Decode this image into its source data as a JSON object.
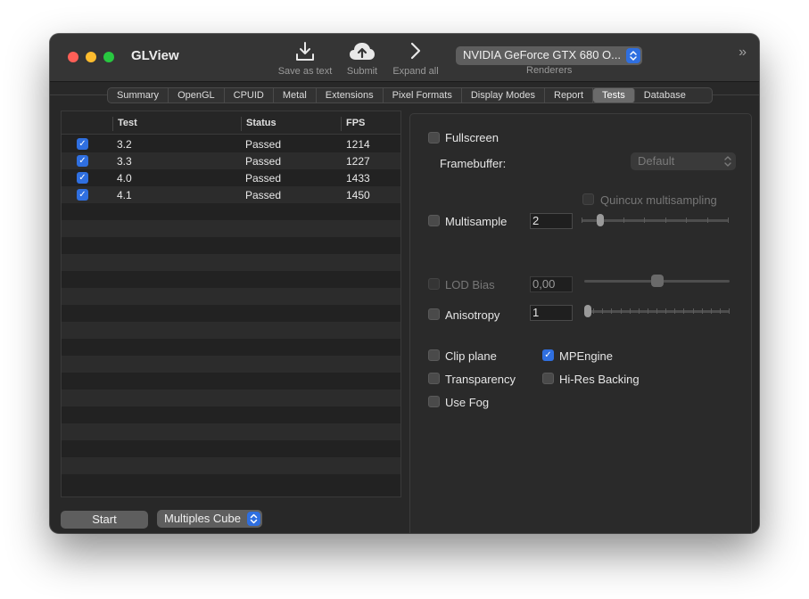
{
  "window": {
    "title": "GLView"
  },
  "toolbar": {
    "save_label": "Save as text",
    "submit_label": "Submit",
    "expand_label": "Expand all",
    "renderer_value": "NVIDIA GeForce GTX 680 O...",
    "renderers_label": "Renderers",
    "overflow_glyph": "»"
  },
  "tabs": [
    "Summary",
    "OpenGL",
    "CPUID",
    "Metal",
    "Extensions",
    "Pixel Formats",
    "Display Modes",
    "Report",
    "Tests",
    "Database"
  ],
  "active_tab": "Tests",
  "table": {
    "headers": {
      "test": "Test",
      "status": "Status",
      "fps": "FPS"
    },
    "rows": [
      {
        "checked": true,
        "test": "3.2",
        "status": "Passed",
        "fps": "1214"
      },
      {
        "checked": true,
        "test": "3.3",
        "status": "Passed",
        "fps": "1227"
      },
      {
        "checked": true,
        "test": "4.0",
        "status": "Passed",
        "fps": "1433"
      },
      {
        "checked": true,
        "test": "4.1",
        "status": "Passed",
        "fps": "1450"
      }
    ]
  },
  "bottom": {
    "start_label": "Start",
    "test_select_value": "Multiples Cube"
  },
  "settings": {
    "fullscreen_label": "Fullscreen",
    "framebuffer_label": "Framebuffer:",
    "framebuffer_value": "Default",
    "quincux_label": "Quincux multisampling",
    "multisample_label": "Multisample",
    "multisample_value": "2",
    "multisample_level": 0.11,
    "lod_label": "LOD Bias",
    "lod_value": "0,00",
    "lod_level": 0.5,
    "anisotropy_label": "Anisotropy",
    "anisotropy_value": "1",
    "anisotropy_level": 0.0,
    "clip_label": "Clip plane",
    "mpengine_label": "MPEngine",
    "mpengine_checked": true,
    "transparency_label": "Transparency",
    "hires_label": "Hi-Res Backing",
    "fog_label": "Use Fog"
  },
  "colors": {
    "accent": "#2f6fe0",
    "close": "#ff5f57",
    "minimize": "#febc2e",
    "maximize": "#28c840"
  }
}
